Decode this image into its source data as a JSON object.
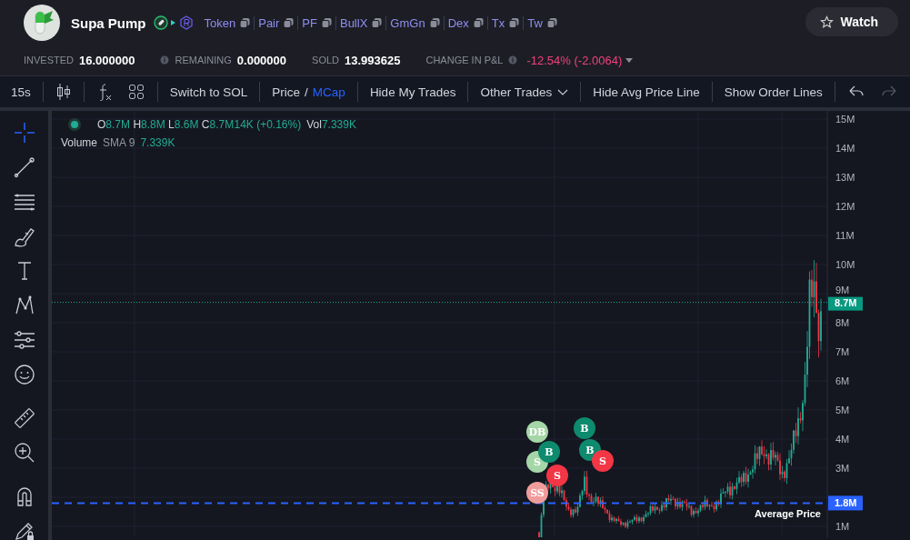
{
  "token": {
    "name": "Supa Pump",
    "links": [
      {
        "label": "Token"
      },
      {
        "label": "Pair"
      },
      {
        "label": "PF"
      },
      {
        "label": "BullX"
      },
      {
        "label": "GmGn"
      },
      {
        "label": "Dex"
      },
      {
        "label": "Tx"
      },
      {
        "label": "Tw"
      }
    ]
  },
  "watch_button": {
    "label": "Watch"
  },
  "stats": [
    {
      "label": "INVESTED",
      "value": "16.000000",
      "kind": "plain"
    },
    {
      "label": "REMAINING",
      "value": "0.000000",
      "kind": "info-before"
    },
    {
      "label": "SOLD",
      "value": "13.993625",
      "kind": "plain"
    },
    {
      "label": "CHANGE IN P&L",
      "value": "-12.54% (-2.0064)",
      "kind": "pnl"
    }
  ],
  "toolbar": {
    "interval": "15s",
    "items": [
      {
        "kind": "button",
        "label": "Switch to SOL"
      },
      {
        "kind": "toggle",
        "separator": "/",
        "options": [
          {
            "label": "Price",
            "selected": false
          },
          {
            "label": "MCap",
            "selected": true
          }
        ]
      },
      {
        "kind": "button",
        "label": "Hide My Trades"
      },
      {
        "kind": "dropdown",
        "label": "Other Trades"
      },
      {
        "kind": "button",
        "label": "Hide Avg Price Line"
      },
      {
        "kind": "button",
        "label": "Show Order Lines"
      }
    ]
  },
  "legend": {
    "ohlc": [
      {
        "key": "O",
        "value": "8.7M"
      },
      {
        "key": "H",
        "value": "8.8M"
      },
      {
        "key": "L",
        "value": "8.6M"
      },
      {
        "key": "C",
        "value": "8.7M"
      }
    ],
    "change": "14K (+0.16%)",
    "vol_label": "Vol",
    "vol_value": "7.339K"
  },
  "volume": {
    "name": "Volume",
    "params": "SMA 9",
    "value": "7.339K"
  },
  "y_axis": [
    "15M",
    "14M",
    "13M",
    "12M",
    "11M",
    "10M",
    "9M",
    "8M",
    "7M",
    "6M",
    "5M",
    "4M",
    "3M",
    "1M"
  ],
  "last_price": {
    "label": "8.7M"
  },
  "average_price": {
    "value": "1.8M",
    "label": "Average Price"
  },
  "trade_markers": [
    {
      "kind": "dev-buy",
      "label": "DB"
    },
    {
      "kind": "sell-light",
      "label": "S"
    },
    {
      "kind": "buy",
      "label": "B"
    },
    {
      "kind": "sell",
      "label": "S"
    },
    {
      "kind": "dev-sell",
      "label": "SS"
    },
    {
      "kind": "buy",
      "label": "B"
    },
    {
      "kind": "buy",
      "label": "B"
    },
    {
      "kind": "sell",
      "label": "S"
    }
  ]
}
